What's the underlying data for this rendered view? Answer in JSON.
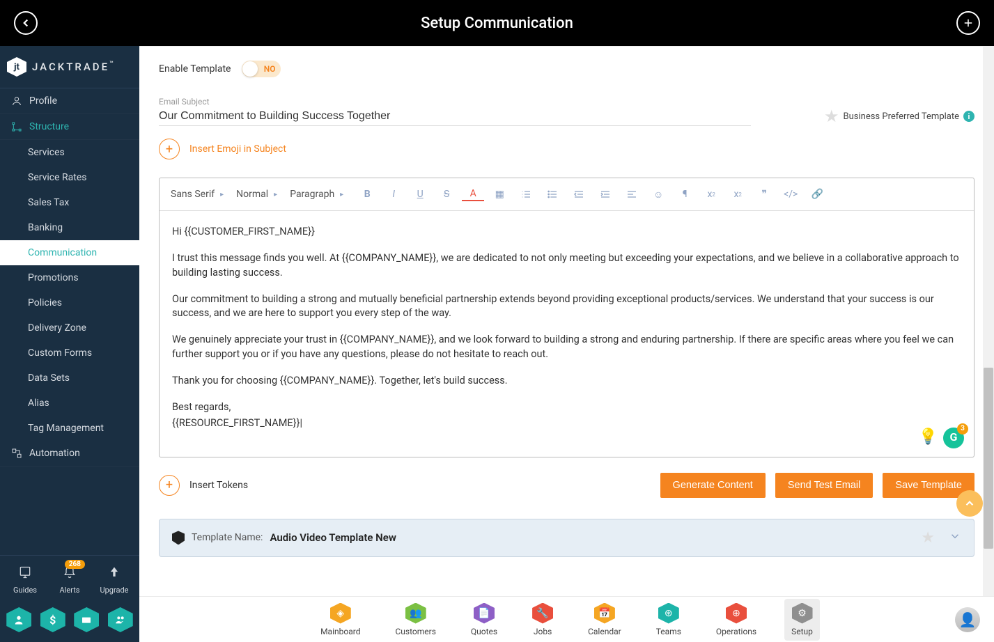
{
  "header": {
    "title": "Setup Communication"
  },
  "brand": {
    "name": "JACKTRADE",
    "badge": "jt"
  },
  "sidebar": {
    "profile": "Profile",
    "structure": "Structure",
    "structure_items": [
      "Services",
      "Service Rates",
      "Sales Tax",
      "Banking",
      "Communication",
      "Promotions",
      "Policies",
      "Delivery Zone",
      "Custom Forms",
      "Data Sets",
      "Alias",
      "Tag Management"
    ],
    "automation": "Automation",
    "bottom": {
      "guides": "Guides",
      "alerts": "Alerts",
      "alerts_count": "268",
      "upgrade": "Upgrade"
    }
  },
  "enable": {
    "label": "Enable Template",
    "value": "NO"
  },
  "subject": {
    "label": "Email Subject",
    "value": "Our Commitment to Building Success Together",
    "preferred": "Business Preferred Template"
  },
  "emoji": {
    "label": "Insert Emoji in Subject"
  },
  "toolbar": {
    "font": "Sans Serif",
    "size": "Normal",
    "block": "Paragraph"
  },
  "editor": {
    "p1": "Hi {{CUSTOMER_FIRST_NAME}}",
    "p2": "I trust this message finds you well. At {{COMPANY_NAME}}, we are dedicated to not only meeting but exceeding your expectations, and we believe in a collaborative approach to building lasting success.",
    "p3": "Our commitment to building a strong and mutually beneficial partnership extends beyond providing exceptional products/services. We understand that your success is our success, and we are here to support you every step of the way.",
    "p4": "We genuinely appreciate your trust in {{COMPANY_NAME}}, and we look forward to building a strong and enduring partnership. If there are specific areas where you feel we can further support you or if you have any questions, please do not hesitate to reach out.",
    "p5": "Thank you for choosing {{COMPANY_NAME}}. Together, let's build success.",
    "p6": "Best regards,",
    "p7": "{{RESOURCE_FIRST_NAME}}|"
  },
  "gram_count": "3",
  "tokens": {
    "label": "Insert Tokens"
  },
  "buttons": {
    "generate": "Generate Content",
    "sendtest": "Send Test Email",
    "save": "Save Template"
  },
  "template_row": {
    "label": "Template Name:",
    "name": "Audio Video Template New"
  },
  "bottom_nav": [
    {
      "label": "Mainboard",
      "color": "#f5a623"
    },
    {
      "label": "Customers",
      "color": "#7bc043"
    },
    {
      "label": "Quotes",
      "color": "#8e5fc6"
    },
    {
      "label": "Jobs",
      "color": "#e94f3d"
    },
    {
      "label": "Calendar",
      "color": "#f5a623"
    },
    {
      "label": "Teams",
      "color": "#1db4a9"
    },
    {
      "label": "Operations",
      "color": "#e94f3d"
    },
    {
      "label": "Setup",
      "color": "#8f8f8f"
    }
  ]
}
